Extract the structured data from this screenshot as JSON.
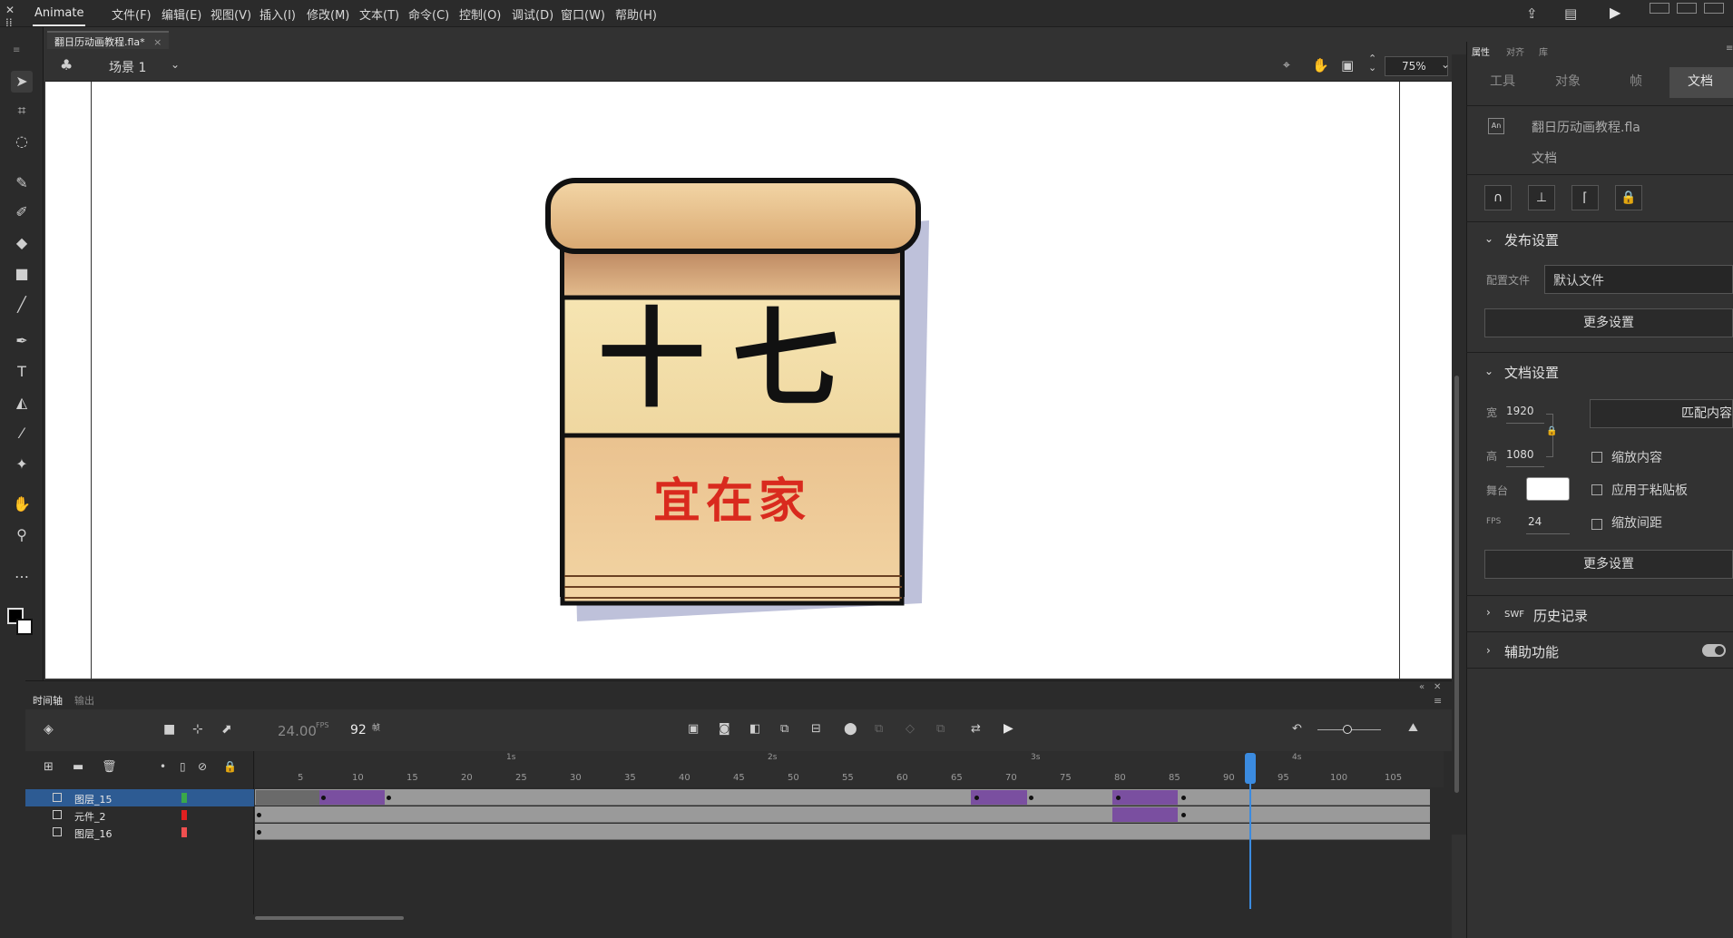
{
  "app": {
    "name": "Animate"
  },
  "menu": [
    "文件(F)",
    "编辑(E)",
    "视图(V)",
    "插入(I)",
    "修改(M)",
    "文本(T)",
    "命令(C)",
    "控制(O)",
    "调试(D)",
    "窗口(W)",
    "帮助(H)"
  ],
  "document": {
    "tab_title": "翻日历动画教程.fla*",
    "close_label": "×"
  },
  "scene": {
    "label": "场景 1",
    "zoom": "75%"
  },
  "artwork": {
    "number_text": "十七",
    "subtitle_text": "宜在家"
  },
  "timeline": {
    "tab_timeline": "时间轴",
    "tab_output": "输出",
    "fps": "24.00",
    "fps_unit": "FPS",
    "current_frame": "92",
    "frame_unit": "帧",
    "ruler_numbers": [
      "5",
      "10",
      "15",
      "20",
      "25",
      "30",
      "35",
      "40",
      "45",
      "50",
      "55",
      "60",
      "65",
      "70",
      "75",
      "80",
      "85",
      "90",
      "95",
      "100",
      "105"
    ],
    "ruler_seconds": [
      "1s",
      "2s",
      "3s",
      "4s"
    ],
    "layers": [
      {
        "name": "图层_15",
        "color": "#3aa84a",
        "selected": true
      },
      {
        "name": "元件_2",
        "color": "#e02020",
        "selected": false
      },
      {
        "name": "图层_16",
        "color": "#f05050",
        "selected": false
      }
    ]
  },
  "properties": {
    "top_tabs": [
      "属性",
      "对齐",
      "库"
    ],
    "tabs": [
      "工具",
      "对象",
      "帧",
      "文档"
    ],
    "file_name": "翻日历动画教程.fla",
    "file_type": "文档",
    "publish_section": "发布设置",
    "profile_label": "配置文件",
    "profile_value": "默认文件",
    "more_settings": "更多设置",
    "doc_section": "文档设置",
    "width_label": "宽",
    "width_value": "1920",
    "height_label": "高",
    "height_value": "1080",
    "match_content": "匹配内容",
    "scale_content": "缩放内容",
    "stage_label": "舞台",
    "apply_pasteboard": "应用于粘贴板",
    "fps_label": "FPS",
    "fps_value": "24",
    "scale_spacing": "缩放间距",
    "more_settings_2": "更多设置",
    "swf_prefix": "SWF",
    "swf_history": "历史记录",
    "accessibility": "辅助功能"
  }
}
